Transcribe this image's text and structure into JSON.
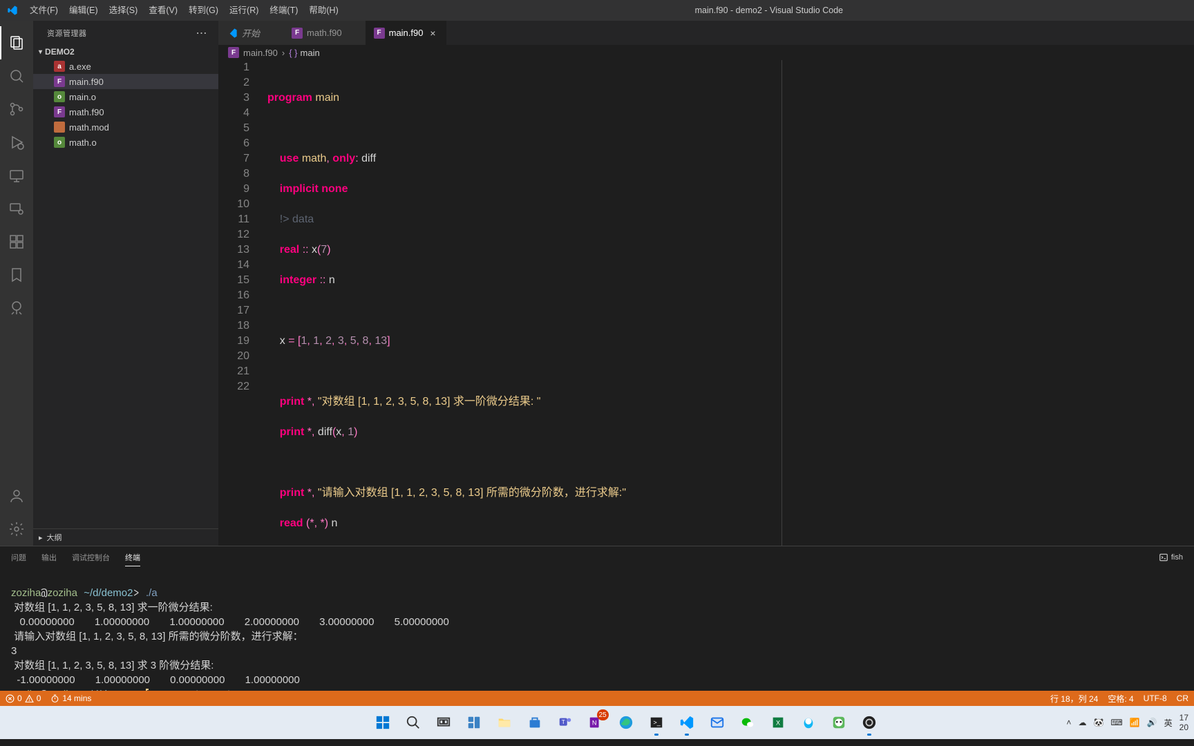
{
  "titlebar": {
    "title": "main.f90 - demo2 - Visual Studio Code",
    "menu": [
      "文件(F)",
      "编辑(E)",
      "选择(S)",
      "查看(V)",
      "转到(G)",
      "运行(R)",
      "终端(T)",
      "帮助(H)"
    ]
  },
  "sidebar": {
    "header": "资源管理器",
    "folder": "DEMO2",
    "files": [
      {
        "name": "a.exe",
        "iconClass": "red",
        "glyph": "a"
      },
      {
        "name": "main.f90",
        "iconClass": "",
        "glyph": "F",
        "active": true
      },
      {
        "name": "main.o",
        "iconClass": "green",
        "glyph": "o"
      },
      {
        "name": "math.f90",
        "iconClass": "",
        "glyph": "F"
      },
      {
        "name": "math.mod",
        "iconClass": "orange",
        "glyph": "</>"
      },
      {
        "name": "math.o",
        "iconClass": "green",
        "glyph": "o"
      }
    ],
    "outline": "大纲"
  },
  "tabs": [
    {
      "label": "开始",
      "kind": "start",
      "italic": true
    },
    {
      "label": "math.f90",
      "kind": "f90"
    },
    {
      "label": "main.f90",
      "kind": "f90",
      "active": true
    }
  ],
  "breadcrumb": {
    "file": "main.f90",
    "symbol": "main"
  },
  "code_lines": [
    "1",
    "2",
    "3",
    "4",
    "5",
    "6",
    "7",
    "8",
    "9",
    "10",
    "11",
    "12",
    "13",
    "14",
    "15",
    "16",
    "17",
    "18",
    "19",
    "20",
    "21",
    "22"
  ],
  "panel": {
    "tabs": [
      "问题",
      "输出",
      "调试控制台",
      "终端"
    ],
    "active": 3,
    "term_kind": "fish"
  },
  "terminal": {
    "user": "zoziha",
    "host": "zoziha",
    "path": "~/d/demo2",
    "cmd": "./a",
    "out1": " 对数组 [1, 1, 2, 3, 5, 8, 13] 求一阶微分结果: ",
    "out2": "   0.00000000       1.00000000       1.00000000       2.00000000       3.00000000       5.00000000",
    "out3": " 请输入对数组 [1, 1, 2, 3, 5, 8, 13] 所需的微分阶数，进行求解：",
    "input": "3",
    "out4": " 对数组 [1, 1, 2, 3, 5, 8, 13] 求 3 阶微分结果: ",
    "out5": "  -1.00000000       1.00000000       0.00000000       1.00000000",
    "suggest_first": "f",
    "suggest_rest": "ortran math.o main.o"
  },
  "status": {
    "errors": "0",
    "warnings": "0",
    "timer": "14 mins",
    "ln_col": "行 18，列 24",
    "spaces": "空格: 4",
    "enc": "UTF-8",
    "eol": "CR"
  },
  "taskbar": {
    "onenote_badge": "25",
    "time": "17",
    "date": "20",
    "ime": "英"
  }
}
